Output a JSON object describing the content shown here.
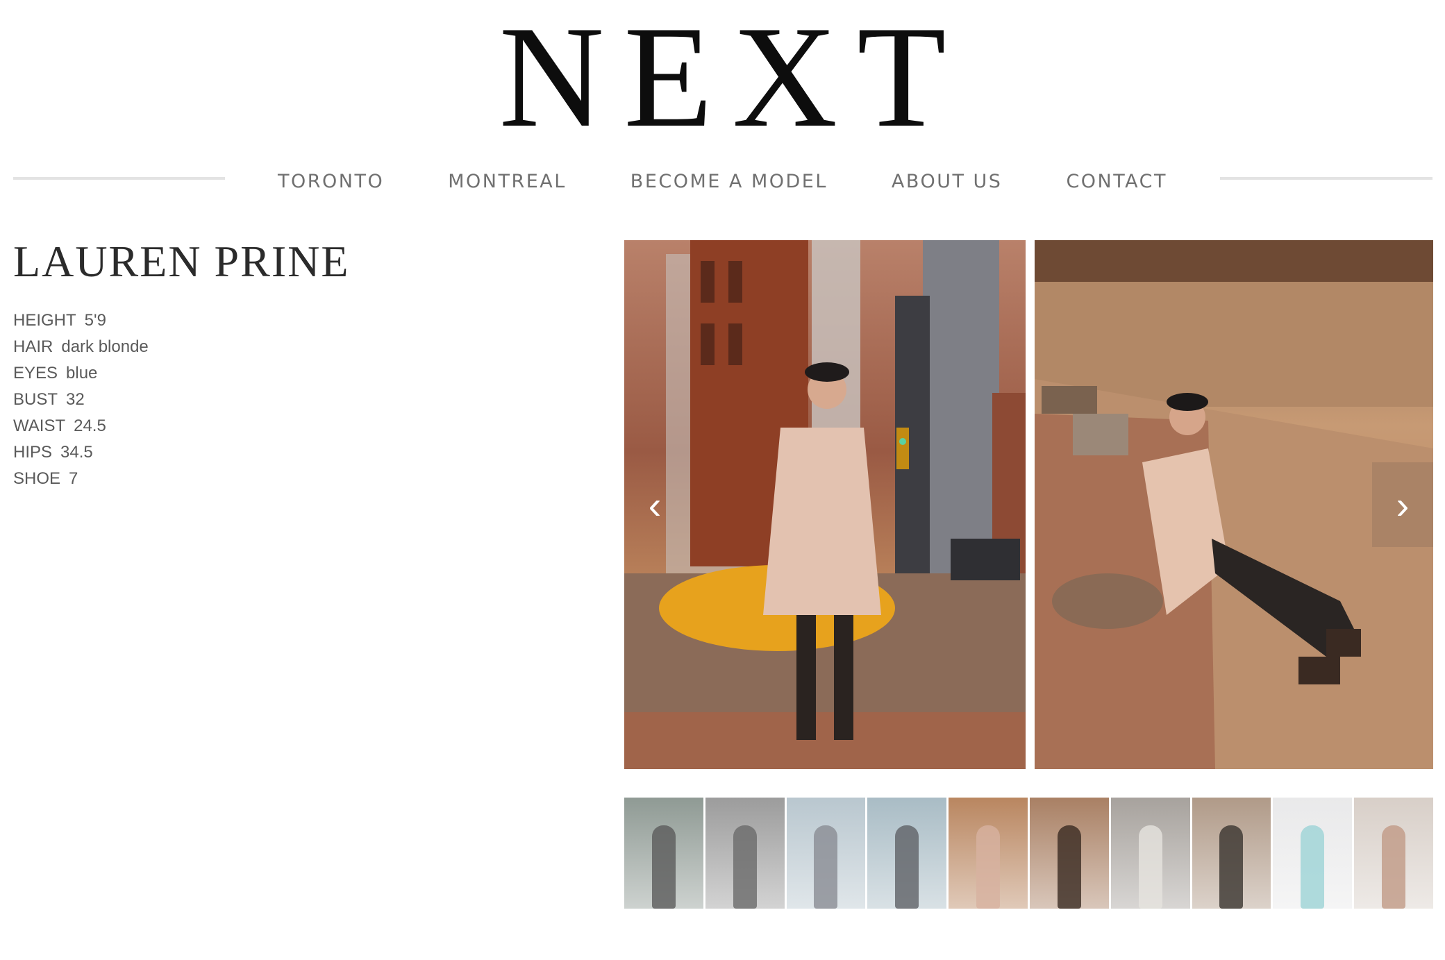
{
  "logo": {
    "text": "NEXT"
  },
  "nav": {
    "items": [
      {
        "label": "TORONTO"
      },
      {
        "label": "MONTREAL"
      },
      {
        "label": "BECOME A MODEL"
      },
      {
        "label": "ABOUT US"
      },
      {
        "label": "CONTACT"
      }
    ]
  },
  "model": {
    "name": "LAUREN PRINE",
    "stats": [
      {
        "key": "HEIGHT",
        "value": "5'9"
      },
      {
        "key": "HAIR",
        "value": "dark blonde"
      },
      {
        "key": "EYES",
        "value": "blue"
      },
      {
        "key": "BUST",
        "value": "32"
      },
      {
        "key": "WAIST",
        "value": "24.5"
      },
      {
        "key": "HIPS",
        "value": "34.5"
      },
      {
        "key": "SHOE",
        "value": "7"
      }
    ]
  },
  "gallery": {
    "prev_icon": "chevron-left-icon",
    "next_icon": "chevron-right-icon",
    "prev_glyph": "‹",
    "next_glyph": "›"
  },
  "thumbnails": [
    {
      "tone": "#8f9a94",
      "fig": "#5b5b5b"
    },
    {
      "tone": "#9c9c9c",
      "fig": "#6a6a6a"
    },
    {
      "tone": "#b9c7cf",
      "fig": "#8a8c94"
    },
    {
      "tone": "#a9bcc5",
      "fig": "#5f6166"
    },
    {
      "tone": "#b98660",
      "fig": "#d7b2a0"
    },
    {
      "tone": "#a98064",
      "fig": "#3a2a22"
    },
    {
      "tone": "#a7a29d",
      "fig": "#e6e3df"
    },
    {
      "tone": "#b09a88",
      "fig": "#3a3430"
    },
    {
      "tone": "#e9e9ea",
      "fig": "#9cd3d6"
    },
    {
      "tone": "#d8cfc8",
      "fig": "#c09a86"
    }
  ]
}
